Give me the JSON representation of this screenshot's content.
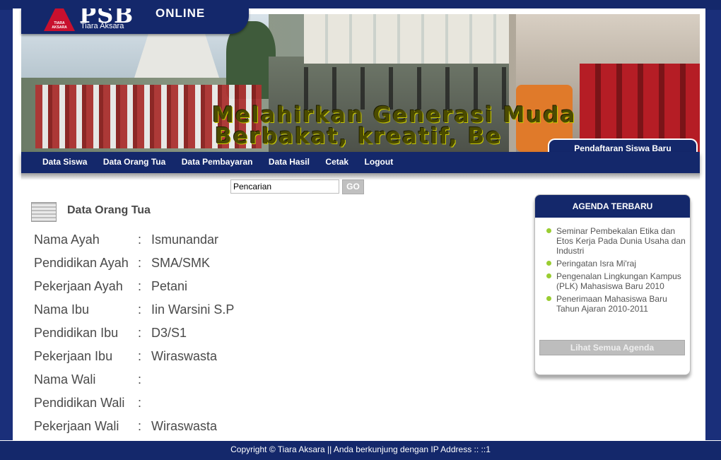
{
  "header": {
    "logo_emblem_text": "TIARA AKSARA",
    "logo_psb": "PSB",
    "logo_online": "ONLINE",
    "logo_sub": "Tiara Aksara",
    "slogan_line1": "Melahirkan Generasi Muda",
    "slogan_line2": "Berbakat, kreatif, Be",
    "registration_tab": "Pendaftaran Siswa Baru"
  },
  "nav": {
    "items": [
      {
        "label": "Data Siswa"
      },
      {
        "label": "Data Orang Tua"
      },
      {
        "label": "Data Pembayaran"
      },
      {
        "label": "Data Hasil"
      },
      {
        "label": "Cetak"
      },
      {
        "label": "Logout"
      }
    ]
  },
  "search": {
    "value": "Pencarian",
    "button_label": "GO"
  },
  "main": {
    "section_title": "Data Orang Tua",
    "separator": ":",
    "fields": [
      {
        "label": "Nama Ayah",
        "value": "Ismunandar"
      },
      {
        "label": "Pendidikan Ayah",
        "value": "SMA/SMK"
      },
      {
        "label": "Pekerjaan Ayah",
        "value": "Petani"
      },
      {
        "label": "Nama Ibu",
        "value": "Iin Warsini S.P"
      },
      {
        "label": "Pendidikan Ibu",
        "value": "D3/S1"
      },
      {
        "label": "Pekerjaan Ibu",
        "value": "Wiraswasta"
      },
      {
        "label": "Nama Wali",
        "value": ""
      },
      {
        "label": "Pendidikan Wali",
        "value": ""
      },
      {
        "label": "Pekerjaan Wali",
        "value": "Wiraswasta"
      }
    ]
  },
  "agenda": {
    "title": "AGENDA TERBARU",
    "items": [
      {
        "text": "Seminar Pembekalan Etika dan Etos Kerja Pada Dunia Usaha dan Industri"
      },
      {
        "text": "Peringatan Isra Mi'raj"
      },
      {
        "text": "Pengenalan Lingkungan Kampus (PLK) Mahasiswa Baru 2010"
      },
      {
        "text": "Penerimaan Mahasiswa Baru Tahun Ajaran 2010-2011"
      }
    ],
    "all_button": "Lihat Semua Agenda"
  },
  "footer": {
    "text": "Copyright © Tiara Aksara || Anda berkunjung dengan IP Address :: ::1"
  },
  "colors": {
    "brand_navy": "#14286b",
    "bullet_green": "#9acd32"
  }
}
